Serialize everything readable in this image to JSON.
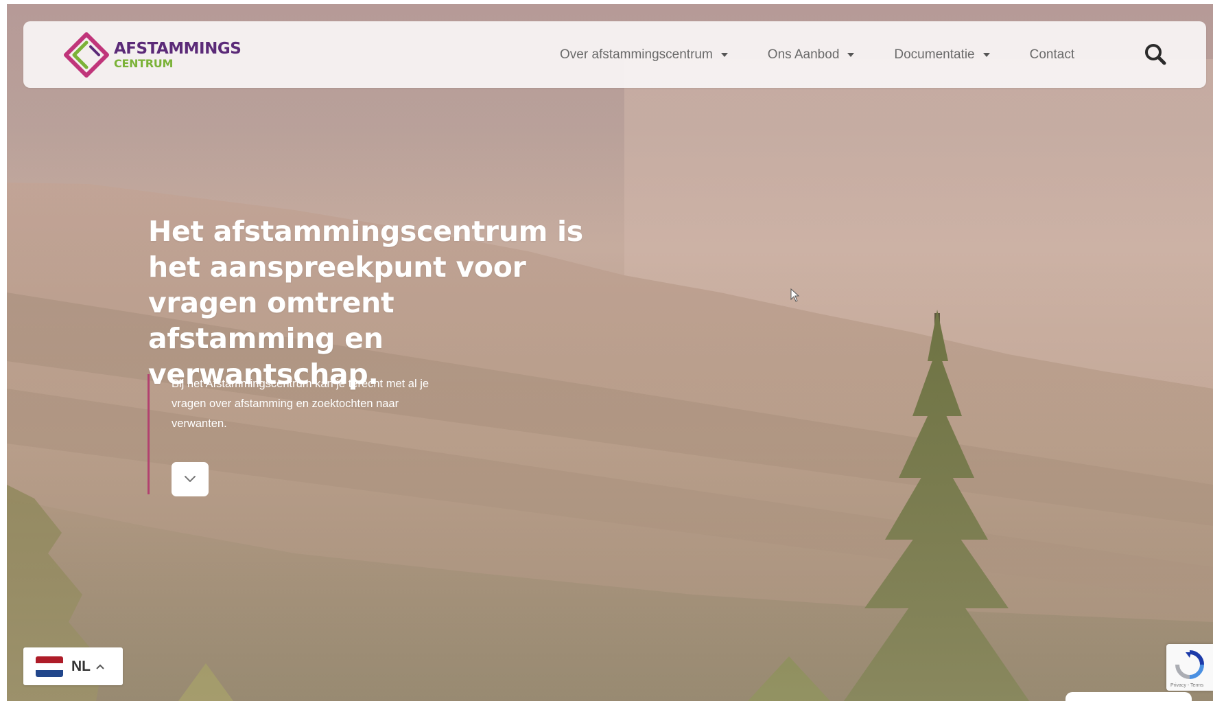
{
  "brand": {
    "line1": "AFSTAMMINGS",
    "line2": "CENTRUM",
    "colors": {
      "purple": "#5b2a78",
      "magenta": "#c0357a",
      "green": "#7bb238"
    }
  },
  "nav": {
    "items": [
      {
        "label": "Over afstammingscentrum",
        "has_dropdown": true
      },
      {
        "label": "Ons Aanbod",
        "has_dropdown": true
      },
      {
        "label": "Documentatie",
        "has_dropdown": true
      },
      {
        "label": "Contact",
        "has_dropdown": false
      }
    ],
    "search_icon": "search-icon"
  },
  "hero": {
    "headline": "Het afstammingscentrum is het aanspreekpunt voor vragen omtrent afstamming en verwantschap.",
    "subtext": "Bij het Afstammingscentrum kan je terecht met al je vragen over afstamming en zoektochten naar verwanten.",
    "scroll_icon": "chevron-down-icon",
    "accent_color": "#b2416f"
  },
  "language": {
    "code": "NL",
    "flag_icon": "netherlands-flag-icon",
    "caret_icon": "chevron-up-icon"
  },
  "recaptcha": {
    "icon": "recaptcha-icon",
    "note": "Privacy - Terms"
  }
}
